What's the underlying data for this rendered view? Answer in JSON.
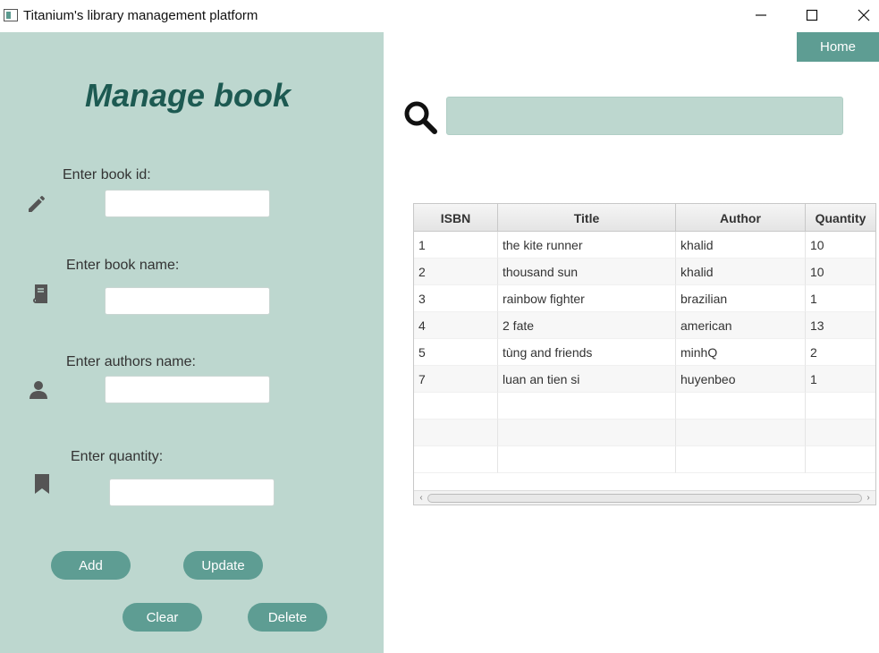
{
  "window": {
    "title": "Titanium's library management platform"
  },
  "left_panel": {
    "title": "Manage book",
    "fields": [
      {
        "label": "Enter book id:",
        "icon": "pencil-icon",
        "value": ""
      },
      {
        "label": "Enter book name:",
        "icon": "book-icon",
        "value": ""
      },
      {
        "label": "Enter authors name:",
        "icon": "user-icon",
        "value": ""
      },
      {
        "label": "Enter quantity:",
        "icon": "bookmark-icon",
        "value": ""
      }
    ],
    "buttons": {
      "add": "Add",
      "update": "Update",
      "clear": "Clear",
      "delete": "Delete"
    }
  },
  "header": {
    "home_label": "Home"
  },
  "search": {
    "value": "",
    "icon": "search-icon"
  },
  "table": {
    "columns": [
      "ISBN",
      "Title",
      "Author",
      "Quantity"
    ],
    "rows": [
      [
        "1",
        "the kite runner",
        "khalid",
        "10"
      ],
      [
        "2",
        "thousand sun",
        "khalid",
        "10"
      ],
      [
        "3",
        "rainbow fighter",
        "brazilian",
        "1"
      ],
      [
        "4",
        "2 fate",
        "american",
        "13"
      ],
      [
        "5",
        "tùng and friends",
        "minhQ",
        "2"
      ],
      [
        "7",
        "luan an tien si",
        "huyenbeo",
        "1"
      ]
    ]
  },
  "colors": {
    "panel_bg": "#bdd7cf",
    "accent": "#5e9d93",
    "title_color": "#1d5a52"
  }
}
